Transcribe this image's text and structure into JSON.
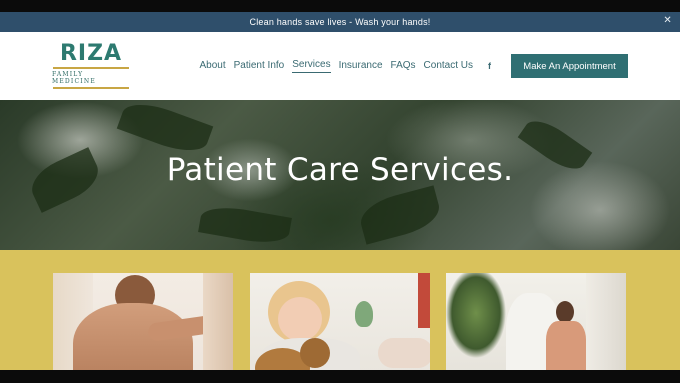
{
  "announcement": {
    "text": "Clean hands save lives - Wash your hands!",
    "close_icon": "close-icon"
  },
  "logo": {
    "wordmark": "RIZA",
    "tagline": "FAMILY MEDICINE"
  },
  "nav": {
    "items": [
      {
        "label": "About"
      },
      {
        "label": "Patient Info"
      },
      {
        "label": "Services",
        "active": true
      },
      {
        "label": "Insurance"
      },
      {
        "label": "FAQs"
      },
      {
        "label": "Contact Us"
      }
    ],
    "social_icon": "facebook-icon",
    "social_glyph": "f",
    "cta_label": "Make An Appointment"
  },
  "hero": {
    "title": "Patient Care Services."
  },
  "services": {
    "cards": [
      {
        "image": "shoulder-examination-photo"
      },
      {
        "image": "child-with-teddy-bear-photo"
      },
      {
        "image": "woman-consultation-photo"
      }
    ]
  },
  "colors": {
    "announcement_bg": "#2f4f6b",
    "brand_teal": "#2f6f73",
    "nav_text": "#3a6a72",
    "logo_gold": "#c8a644",
    "services_bg": "#d9c25c"
  }
}
